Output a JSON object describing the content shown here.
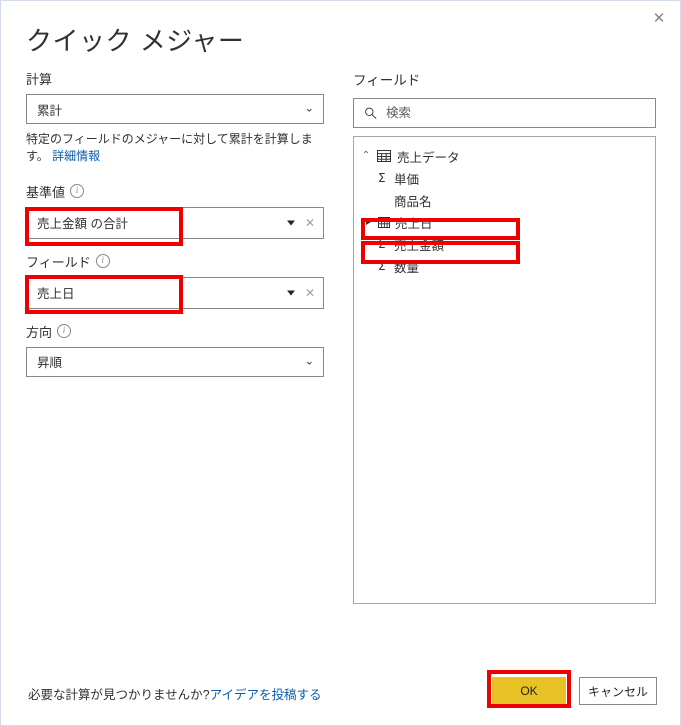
{
  "dialog": {
    "title": "クイック メジャー",
    "close_label": "✕"
  },
  "calculation": {
    "label": "計算",
    "value": "累計",
    "description_text": "特定のフィールドのメジャーに対して累計を計算します。",
    "description_link": "詳細情報"
  },
  "base_value": {
    "label": "基準値",
    "value": "売上金額 の合計",
    "clear_label": "✕"
  },
  "field": {
    "label": "フィールド",
    "value": "売上日",
    "clear_label": "✕"
  },
  "direction": {
    "label": "方向",
    "value": "昇順"
  },
  "fields_pane": {
    "title": "フィールド",
    "search_placeholder": "検索",
    "search_value": "",
    "table": {
      "name": "売上データ",
      "collapse_glyph": "⌃",
      "fields": [
        {
          "name": "単価",
          "icon": "sigma",
          "expandable": false
        },
        {
          "name": "商品名",
          "icon": "none",
          "expandable": false
        },
        {
          "name": "売上日",
          "icon": "calendar",
          "expandable": true
        },
        {
          "name": "売上金額",
          "icon": "sigma",
          "expandable": false
        },
        {
          "name": "数量",
          "icon": "sigma",
          "expandable": false
        }
      ]
    }
  },
  "footer": {
    "note_text": "必要な計算が見つかりませんか?",
    "note_link": "アイデアを投稿する",
    "ok_label": "OK",
    "cancel_label": "キャンセル"
  },
  "colors": {
    "accent_yellow": "#e8c225",
    "link_blue": "#0b5cab",
    "annotation_red": "#ee0000",
    "border_gray": "#8a8886"
  },
  "annotations": [
    {
      "name": "base-value-highlight"
    },
    {
      "name": "field-highlight"
    },
    {
      "name": "date-field-highlight"
    },
    {
      "name": "amount-field-highlight"
    },
    {
      "name": "ok-button-highlight"
    }
  ]
}
